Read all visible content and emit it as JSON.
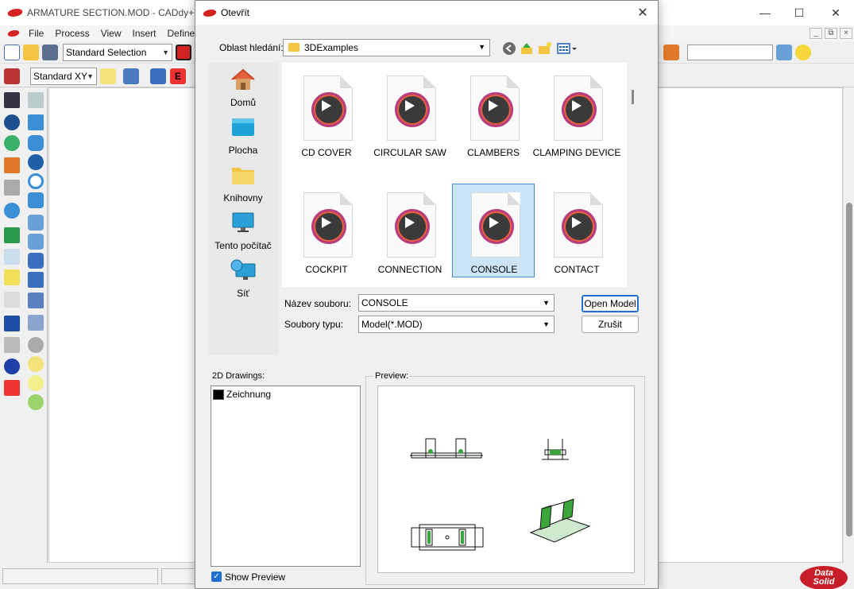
{
  "main": {
    "title": "ARMATURE SECTION.MOD  - CADdy++",
    "menu": [
      "File",
      "Process",
      "View",
      "Insert",
      "Define"
    ],
    "selection_combo": "Standard Selection",
    "view_combo": "Standard XY",
    "tb_e": "E",
    "brand_top": "Data",
    "brand_bottom": "Solid"
  },
  "dialog": {
    "title": "Otevřít",
    "look_in_label": "Oblast hledání:",
    "look_in_value": "3DExamples",
    "places": [
      {
        "label": "Domů",
        "icon": "home-icon"
      },
      {
        "label": "Plocha",
        "icon": "desktop-icon"
      },
      {
        "label": "Knihovny",
        "icon": "libraries-icon"
      },
      {
        "label": "Tento počítač",
        "icon": "this-pc-icon"
      },
      {
        "label": "Síť",
        "icon": "network-icon"
      }
    ],
    "files": [
      {
        "name": "CD COVER"
      },
      {
        "name": "CIRCULAR SAW"
      },
      {
        "name": "CLAMBERS"
      },
      {
        "name": "CLAMPING DEVICE"
      },
      {
        "name": "COCKPIT"
      },
      {
        "name": "CONNECTION"
      },
      {
        "name": "CONSOLE",
        "selected": true
      },
      {
        "name": "CONTACT"
      }
    ],
    "filename_label": "Název souboru:",
    "filename_value": "CONSOLE",
    "filetype_label": "Soubory typu:",
    "filetype_value": "Model(*.MOD)",
    "open_button": "Open Model",
    "cancel_button": "Zrušit",
    "drawings_label": "2D Drawings:",
    "drawings": [
      {
        "name": "Zeichnung"
      }
    ],
    "preview_label": "Preview:",
    "show_preview_label": "Show Preview",
    "show_preview_checked": true
  },
  "colors": {
    "accent": "#1f6fd1",
    "selection_bg": "#cce4f7",
    "brand_red": "#c81e2a"
  }
}
